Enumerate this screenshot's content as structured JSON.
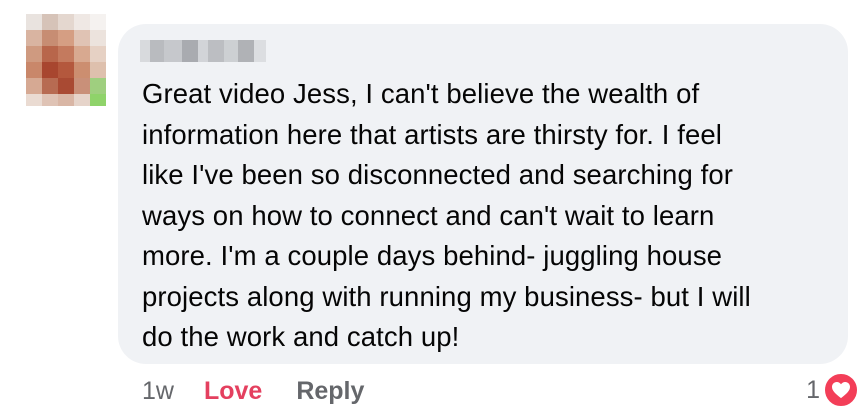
{
  "comment": {
    "lines": [
      "Great video Jess, I can't believe the wealth of",
      "information here that artists are thirsty for.  I feel",
      "like I've been so disconnected and searching for",
      "ways on how to connect and can't wait to learn",
      "more.  I'm a couple days behind- juggling house",
      "projects along with running my business- but I will",
      "do the work and catch up!"
    ]
  },
  "actions": {
    "timestamp": "1w",
    "love_label": "Love",
    "reply_label": "Reply"
  },
  "reactions": {
    "count": "1",
    "icon": "heart-icon"
  },
  "colors": {
    "bubble": "#f0f2f5",
    "love": "#e4405f",
    "heart_badge": "#f33e58",
    "meta_text": "#65676b"
  }
}
